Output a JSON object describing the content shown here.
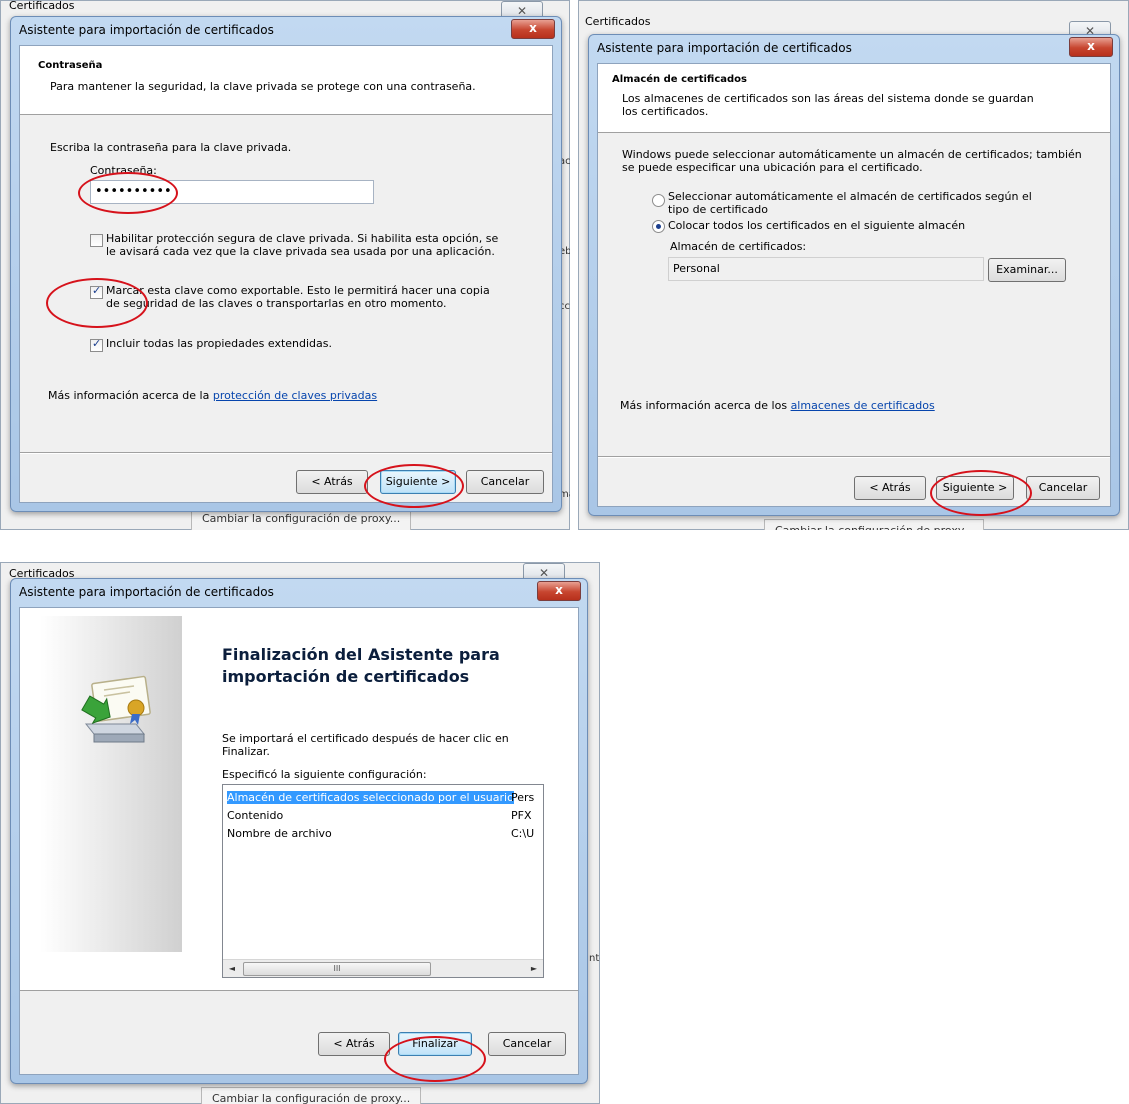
{
  "background": {
    "window_title": "Certificados",
    "close_glyph": "✕",
    "proxy_button": "Cambiar la configuración de proxy...",
    "edge_fragments": [
      "ac",
      "eb",
      "cc",
      "nte",
      "ma"
    ]
  },
  "dialog_title": "Asistente para importación de certificados",
  "close_button_glyph": "x",
  "step_password": {
    "header_title": "Contraseña",
    "header_subtitle": "Para mantener la seguridad, la clave privada se protege con una contraseña.",
    "instruction": "Escriba la contraseña para la clave privada.",
    "password_label": "Contraseña:",
    "password_value": "••••••••••",
    "option_strong_protection": "Habilitar protección segura de clave privada. Si habilita esta opción, se le avisará cada vez que la clave privada sea usada por una aplicación.",
    "option_strong_protection_checked": false,
    "option_exportable": "Marcar esta clave como exportable. Esto le permitirá hacer una copia de seguridad de las claves o transportarlas en otro momento.",
    "option_exportable_checked": true,
    "option_extended": "Incluir todas las propiedades extendidas.",
    "option_extended_checked": true,
    "more_info_prefix": "Más información acerca de la ",
    "more_info_link": "protección de claves privadas",
    "back": "< Atrás",
    "next": "Siguiente >",
    "cancel": "Cancelar"
  },
  "step_store": {
    "header_title": "Almacén de certificados",
    "header_subtitle": "Los almacenes de certificados son las áreas del sistema donde se guardan los certificados.",
    "description": "Windows puede seleccionar automáticamente un almacén de certificados; también se puede especificar una ubicación para el certificado.",
    "radio_auto": "Seleccionar automáticamente el almacén de certificados según el tipo de certificado",
    "radio_auto_selected": false,
    "radio_manual": "Colocar todos los certificados en el siguiente almacén",
    "radio_manual_selected": true,
    "store_label": "Almacén de certificados:",
    "store_value": "Personal",
    "browse": "Examinar...",
    "more_info_prefix": "Más información acerca de los ",
    "more_info_link": "almacenes de certificados",
    "back": "< Atrás",
    "next": "Siguiente >",
    "cancel": "Cancelar"
  },
  "step_finish": {
    "title": "Finalización del Asistente para importación de certificados",
    "message": "Se importará el certificado después de hacer clic en Finalizar.",
    "summary_label": "Especificó la siguiente configuración:",
    "rows": [
      {
        "setting": "Almacén de certificados seleccionado por el usuario",
        "value": "Pers"
      },
      {
        "setting": "Contenido",
        "value": "PFX"
      },
      {
        "setting": "Nombre de archivo",
        "value": "C:\\U"
      }
    ],
    "selected_row": 0,
    "scroll_left": "◄",
    "scroll_right": "►",
    "scroll_thumb": "III",
    "back": "< Atrás",
    "finish": "Finalizar",
    "cancel": "Cancelar"
  },
  "highlight_color": "#d6121b",
  "accent_color": "#3399ff",
  "icons": [
    "certificate-install-icon",
    "close-icon",
    "checkbox-check-icon",
    "radio-dot-icon"
  ]
}
